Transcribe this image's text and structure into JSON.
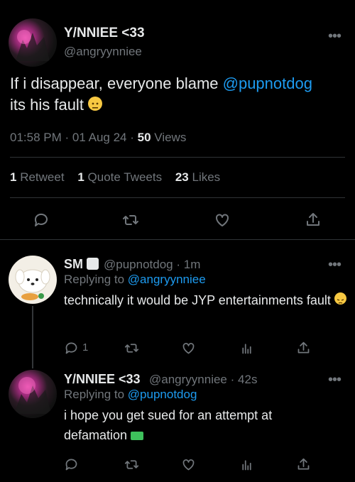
{
  "main_tweet": {
    "author_name": "Y/NNIEE <33",
    "author_handle": "@angryynniee",
    "text_before_mention": "If i disappear, everyone blame ",
    "mention": "@pupnotdog",
    "text_after_mention": "its his fault",
    "emoji": "neutral-face",
    "time": "01:58 PM",
    "date": "01 Aug 24",
    "views_count": "50",
    "views_label": "Views",
    "retweets_count": "1",
    "retweets_label": "Retweet",
    "quotes_count": "1",
    "quotes_label": "Quote Tweets",
    "likes_count": "23",
    "likes_label": "Likes",
    "more": "•••"
  },
  "replies": [
    {
      "author_name": "SM",
      "author_handle": "@pupnotdog",
      "time": "1m",
      "replying_label": "Replying to",
      "replying_to": "@angryynniee",
      "text": "technically it would be JYP entertainments fault",
      "emoji": "pensive-face",
      "reply_count": "1",
      "more": "•••"
    },
    {
      "author_name": "Y/NNIEE <33",
      "author_handle": "@angryynniee",
      "time": "42s",
      "replying_label": "Replying to",
      "replying_to": "@pupnotdog",
      "text": "i hope you get sued for an attempt at defamation",
      "emoji": "water-pistol",
      "more": "•••"
    }
  ],
  "dot_separator": "·",
  "colors": {
    "background": "#000000",
    "text": "#e7e9ea",
    "muted": "#71767b",
    "accent": "#1d9bf0",
    "divider": "#2f3336"
  }
}
